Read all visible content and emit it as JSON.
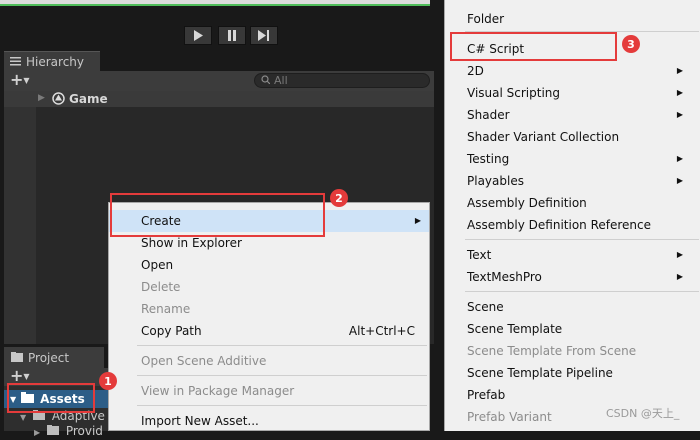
{
  "colors": {
    "accent_red": "#e43b3b",
    "selection_blue": "#2c5d87",
    "menu_bg": "#f0f0f0",
    "hover": "#cfe3f7"
  },
  "toolbar": {
    "play_icon": "play-icon",
    "pause_icon": "pause-icon",
    "step_icon": "step-icon"
  },
  "hierarchy": {
    "tab_label": "Hierarchy",
    "add_button": "+",
    "search_placeholder": "All",
    "root_object": "Game"
  },
  "project": {
    "tab_label": "Project",
    "add_button": "+",
    "assets_label": "Assets",
    "adaptive_label": "Adaptive",
    "provider_label": "Provid"
  },
  "context_menu": {
    "create": "Create",
    "show_in_explorer": "Show in Explorer",
    "open": "Open",
    "delete": "Delete",
    "rename": "Rename",
    "copy_path": "Copy Path",
    "copy_path_shortcut": "Alt+Ctrl+C",
    "open_scene_additive": "Open Scene Additive",
    "view_in_package_manager": "View in Package Manager",
    "import_new_asset": "Import New Asset..."
  },
  "submenu": {
    "items": [
      {
        "label": "Folder"
      },
      {
        "label": "C# Script"
      },
      {
        "label": "2D"
      },
      {
        "label": "Visual Scripting"
      },
      {
        "label": "Shader"
      },
      {
        "label": "Shader Variant Collection"
      },
      {
        "label": "Testing"
      },
      {
        "label": "Playables"
      },
      {
        "label": "Assembly Definition"
      },
      {
        "label": "Assembly Definition Reference"
      },
      {
        "label": "Text"
      },
      {
        "label": "TextMeshPro"
      },
      {
        "label": "Scene"
      },
      {
        "label": "Scene Template"
      },
      {
        "label": "Scene Template From Scene"
      },
      {
        "label": "Scene Template Pipeline"
      },
      {
        "label": "Prefab"
      },
      {
        "label": "Prefab Variant"
      }
    ]
  },
  "annotations": {
    "badge1": "1",
    "badge2": "2",
    "badge3": "3"
  },
  "watermark": "CSDN @天上_"
}
